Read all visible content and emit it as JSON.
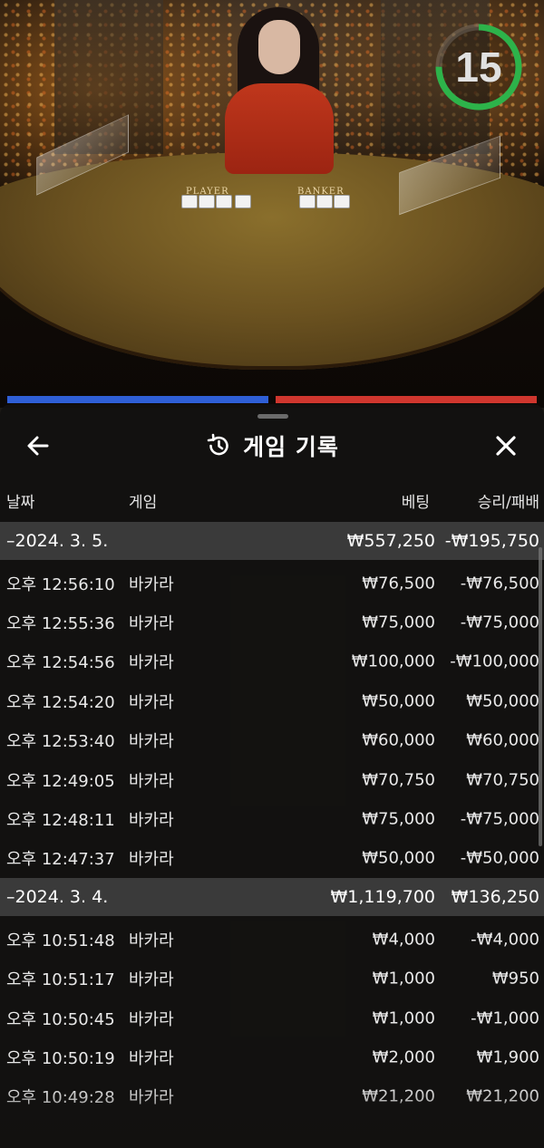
{
  "video": {
    "player_label": "PLAYER",
    "banker_label": "BANKER",
    "timer_value": "15",
    "timer_fraction": 0.75,
    "timer_color": "#2db34a"
  },
  "bet_strip": {
    "player_color": "#2f5fd6",
    "banker_color": "#d0362e"
  },
  "history": {
    "title": "게임 기록",
    "icons": {
      "back": "arrow-left-icon",
      "history": "history-clock-icon",
      "close": "close-icon"
    },
    "columns": {
      "date": "날짜",
      "game": "게임",
      "bet": "베팅",
      "win_loss": "승리/패배"
    },
    "groups": [
      {
        "date": "–2024. 3. 5.",
        "total_bet": "₩557,250",
        "total_result": "-₩195,750",
        "rows": [
          {
            "time": "오후 12:56:10",
            "game": "바카라",
            "bet": "₩76,500",
            "result": "-₩76,500"
          },
          {
            "time": "오후 12:55:36",
            "game": "바카라",
            "bet": "₩75,000",
            "result": "-₩75,000"
          },
          {
            "time": "오후 12:54:56",
            "game": "바카라",
            "bet": "₩100,000",
            "result": "-₩100,000"
          },
          {
            "time": "오후 12:54:20",
            "game": "바카라",
            "bet": "₩50,000",
            "result": "₩50,000"
          },
          {
            "time": "오후 12:53:40",
            "game": "바카라",
            "bet": "₩60,000",
            "result": "₩60,000"
          },
          {
            "time": "오후 12:49:05",
            "game": "바카라",
            "bet": "₩70,750",
            "result": "₩70,750"
          },
          {
            "time": "오후 12:48:11",
            "game": "바카라",
            "bet": "₩75,000",
            "result": "-₩75,000"
          },
          {
            "time": "오후 12:47:37",
            "game": "바카라",
            "bet": "₩50,000",
            "result": "-₩50,000"
          }
        ]
      },
      {
        "date": "–2024. 3. 4.",
        "total_bet": "₩1,119,700",
        "total_result": "₩136,250",
        "rows": [
          {
            "time": "오후 10:51:48",
            "game": "바카라",
            "bet": "₩4,000",
            "result": "-₩4,000"
          },
          {
            "time": "오후 10:51:17",
            "game": "바카라",
            "bet": "₩1,000",
            "result": "₩950"
          },
          {
            "time": "오후 10:50:45",
            "game": "바카라",
            "bet": "₩1,000",
            "result": "-₩1,000"
          },
          {
            "time": "오후 10:50:19",
            "game": "바카라",
            "bet": "₩2,000",
            "result": "₩1,900"
          },
          {
            "time": "오후 10:49:28",
            "game": "바카라",
            "bet": "₩21,200",
            "result": "₩21,200"
          }
        ]
      }
    ]
  }
}
